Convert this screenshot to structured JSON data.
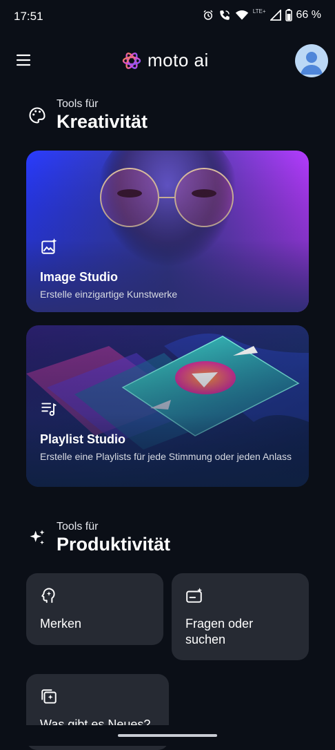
{
  "status_bar": {
    "time": "17:51",
    "network": "LTE+",
    "battery": "66 %",
    "icons": [
      "alarm-icon",
      "wifi-call-icon",
      "wifi-icon",
      "signal-icon",
      "battery-icon"
    ]
  },
  "app_bar": {
    "logo_text": "moto ai",
    "menu_icon": "hamburger-menu-icon",
    "avatar_icon": "user-avatar"
  },
  "creativity": {
    "small": "Tools für",
    "big": "Kreativität",
    "icon": "palette-icon"
  },
  "image_studio": {
    "title": "Image Studio",
    "subtitle": "Erstelle einzigartige Kunstwerke",
    "icon": "image-sparkle-icon"
  },
  "playlist_studio": {
    "title": "Playlist Studio",
    "subtitle": "Erstelle eine Playlists für jede Stimmung oder jeden Anlass",
    "icon": "music-list-icon"
  },
  "productivity": {
    "small": "Tools für",
    "big": "Produktivität",
    "icon": "sparkles-icon"
  },
  "tiles": {
    "remember": "Merken",
    "ask_search": "Fragen oder suchen",
    "whats_new": "Was gibt es Neues?"
  },
  "colors": {
    "background": "#0b0f17",
    "tile": "#262a33",
    "accent_purple": "#8a3cff",
    "accent_orange": "#ff7a2f"
  }
}
